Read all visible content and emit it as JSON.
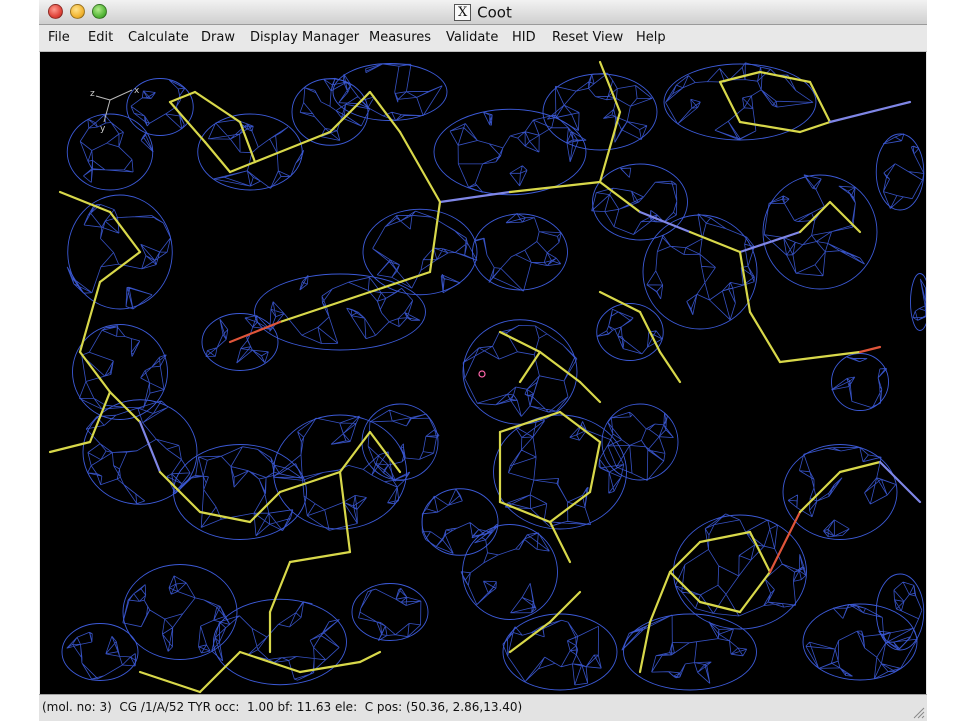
{
  "window": {
    "title": "Coot",
    "logo_glyph": "X"
  },
  "menu": {
    "items": [
      {
        "label": "File"
      },
      {
        "label": "Edit"
      },
      {
        "label": "Calculate"
      },
      {
        "label": "Draw"
      },
      {
        "label": "Display Manager"
      },
      {
        "label": "Measures"
      },
      {
        "label": "Validate"
      },
      {
        "label": "HID"
      },
      {
        "label": "Reset View"
      },
      {
        "label": "Help"
      }
    ]
  },
  "viewport": {
    "background": "#000000",
    "map_color": "#3c5ad7",
    "carbon_color": "#d8d84a",
    "oxygen_color": "#e0553a",
    "nitrogen_color": "#7f86e6",
    "axes": {
      "x": "x",
      "y": "y",
      "z": "z"
    }
  },
  "status": {
    "text": "(mol. no: 3)  CG /1/A/52 TYR occ:  1.00 bf: 11.63 ele:  C pos: (50.36, 2.86,13.40)"
  }
}
